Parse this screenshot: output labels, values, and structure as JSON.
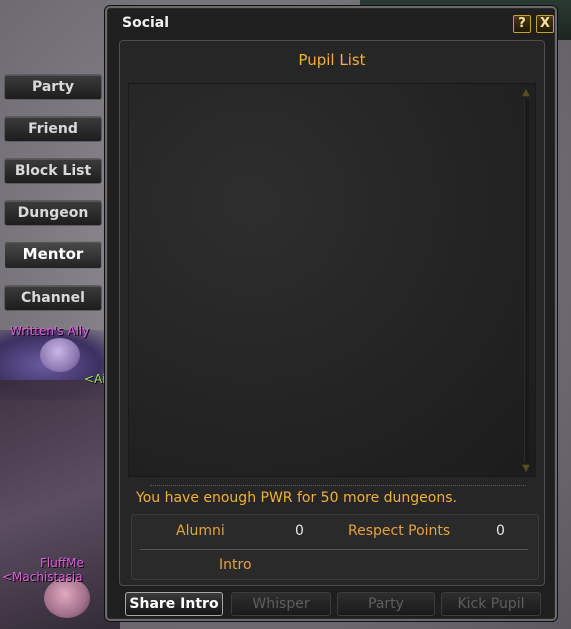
{
  "world": {
    "labels": [
      {
        "text": "Written's Ally"
      },
      {
        "text": "<Ai"
      },
      {
        "text": "FluffMe"
      },
      {
        "text": "<Machistasia"
      }
    ]
  },
  "side_tabs": [
    {
      "label": "Party",
      "active": false
    },
    {
      "label": "Friend",
      "active": false
    },
    {
      "label": "Block List",
      "active": false
    },
    {
      "label": "Dungeon",
      "active": false
    },
    {
      "label": "Mentor",
      "active": true
    },
    {
      "label": "Channel",
      "active": false
    }
  ],
  "window": {
    "title": "Social",
    "help_label": "?",
    "close_label": "X"
  },
  "panel": {
    "title": "Pupil List",
    "pwr_message": "You have enough PWR for 50 more dungeons.",
    "stats": {
      "alumni_label": "Alumni",
      "alumni_value": "0",
      "respect_label": "Respect Points",
      "respect_value": "0",
      "intro_label": "Intro"
    }
  },
  "actions": [
    {
      "label": "Share Intro",
      "enabled": true
    },
    {
      "label": "Whisper",
      "enabled": false
    },
    {
      "label": "Party",
      "enabled": false
    },
    {
      "label": "Kick Pupil",
      "enabled": false
    }
  ],
  "colors": {
    "accent_gold": "#f2b036",
    "stat_label": "#e8a23a",
    "window_bg": "#1f1f1f"
  }
}
